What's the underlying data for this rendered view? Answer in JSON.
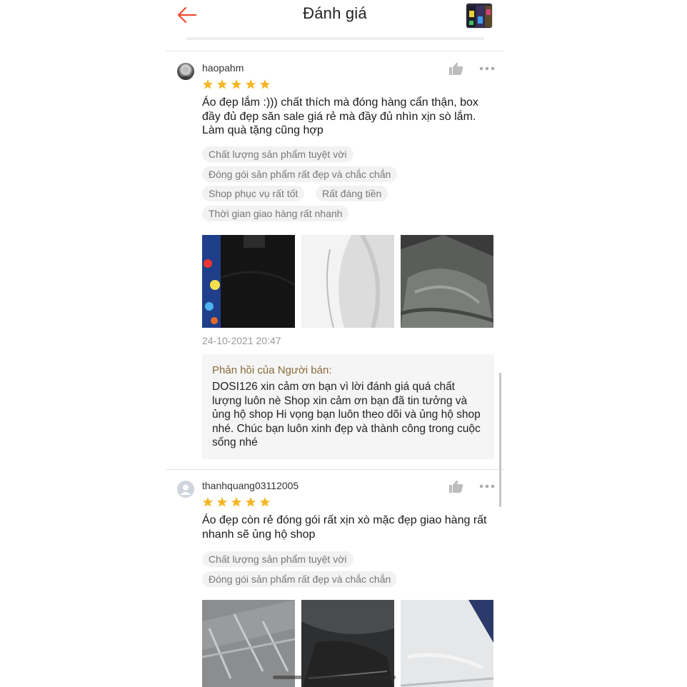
{
  "header": {
    "title": "Đánh giá",
    "back_icon": "back-arrow-icon",
    "accent_color": "#ee4d2d"
  },
  "reviews": [
    {
      "username": "haopahm",
      "rating": 5,
      "text": "Áo đẹp lắm :))) chất thích mà đóng hàng cẩn thận, box đầy đủ đẹp săn sale giá rẻ mà đầy đủ nhìn xịn sò lắm. Làm quà tặng cũng hợp",
      "tags": [
        "Chất lượng sản phẩm tuyệt vời",
        "Đóng gói sản phẩm rất đẹp và chắc chắn",
        "Shop phục vụ rất tốt",
        "Rất đáng tiền",
        "Thời gian giao hàng rất nhanh"
      ],
      "date": "24-10-2021 20:47",
      "seller_reply": {
        "title": "Phản hồi của Người bán:",
        "text": "DOSI126 xin cảm ơn bạn vì lời đánh giá quá chất lượng luôn nè Shop xin cảm ơn bạn đã tin tưởng và ủng hộ shop Hi vọng bạn luôn theo dõi và ủng hộ shop nhé. Chúc bạn luôn xinh đẹp và thành công trong cuộc sống nhé"
      }
    },
    {
      "username": "thanhquang03112005",
      "rating": 5,
      "text": "Áo đẹp còn rẻ đóng gói rất xịn xò mặc đẹp giao hàng rất nhanh sẽ ủng hộ shop",
      "tags": [
        "Chất lượng sản phẩm tuyệt vời",
        "Đóng gói sản phẩm rất đẹp và chắc chắn"
      ]
    }
  ],
  "colors": {
    "star": "#f5b623",
    "tag_bg": "#f2f2f2",
    "reply_title": "#8a6a3a"
  }
}
